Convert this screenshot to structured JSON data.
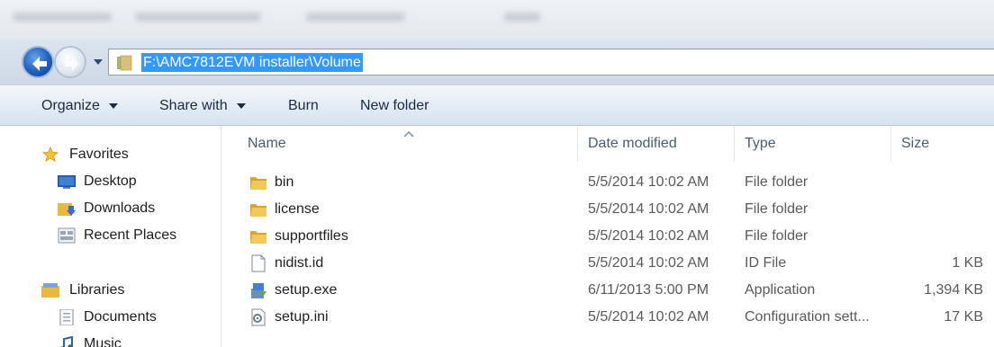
{
  "address": {
    "path": "F:\\AMC7812EVM installer\\Volume"
  },
  "toolbar": {
    "organize_label": "Organize",
    "share_label": "Share with",
    "burn_label": "Burn",
    "new_folder_label": "New folder"
  },
  "navigation": {
    "favorites": {
      "header": "Favorites",
      "items": [
        {
          "label": "Desktop",
          "icon": "desktop-icon"
        },
        {
          "label": "Downloads",
          "icon": "downloads-icon"
        },
        {
          "label": "Recent Places",
          "icon": "recent-places-icon"
        }
      ]
    },
    "libraries": {
      "header": "Libraries",
      "items": [
        {
          "label": "Documents",
          "icon": "documents-icon"
        },
        {
          "label": "Music",
          "icon": "music-icon"
        }
      ]
    }
  },
  "file_list": {
    "columns": [
      "Name",
      "Date modified",
      "Type",
      "Size"
    ],
    "sorted_by": "Name",
    "rows": [
      {
        "name": "bin",
        "date": "5/5/2014 10:02 AM",
        "type": "File folder",
        "size": "",
        "icon": "folder-icon"
      },
      {
        "name": "license",
        "date": "5/5/2014 10:02 AM",
        "type": "File folder",
        "size": "",
        "icon": "folder-icon"
      },
      {
        "name": "supportfiles",
        "date": "5/5/2014 10:02 AM",
        "type": "File folder",
        "size": "",
        "icon": "folder-icon"
      },
      {
        "name": "nidist.id",
        "date": "5/5/2014 10:02 AM",
        "type": "ID File",
        "size": "1 KB",
        "icon": "blank-file-icon"
      },
      {
        "name": "setup.exe",
        "date": "6/11/2013 5:00 PM",
        "type": "Application",
        "size": "1,394 KB",
        "icon": "installer-icon"
      },
      {
        "name": "setup.ini",
        "date": "5/5/2014 10:02 AM",
        "type": "Configuration sett...",
        "size": "17 KB",
        "icon": "config-file-icon"
      }
    ]
  },
  "colors": {
    "selection_highlight": "#3399ff",
    "toolbar_text": "#1b2a44",
    "folder_yellow": "#e8b93c"
  }
}
